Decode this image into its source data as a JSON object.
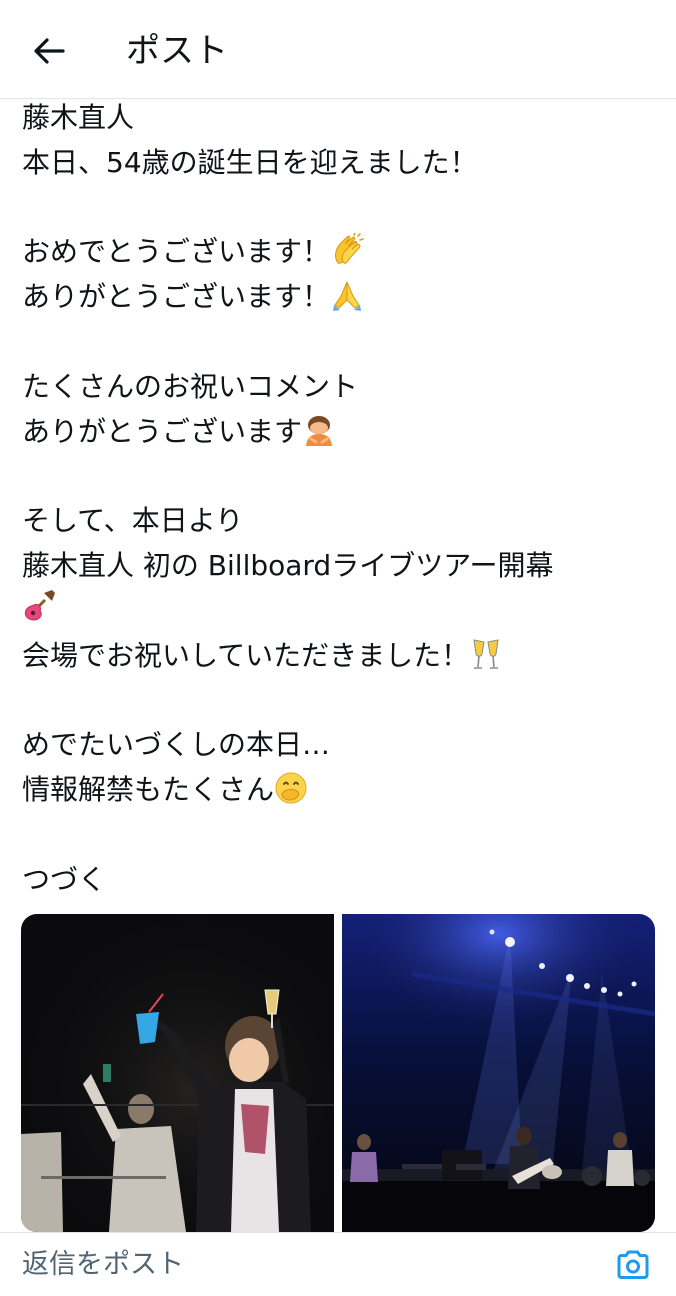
{
  "header": {
    "title": "ポスト",
    "back_icon": "arrow-left-icon"
  },
  "post": {
    "lines": [
      "藤木直人",
      "本日、54歳の誕生日を迎えました！",
      "",
      "おめでとうございます！",
      "ありがとうございます！",
      "",
      "たくさんのお祝いコメント",
      "ありがとうございます",
      "",
      "そして、本日より",
      "藤木直人 初の Billboardライブツアー開幕",
      "",
      "会場でお祝いしていただきました！",
      "",
      "めでたいづくしの本日…",
      "情報解禁もたくさん",
      "",
      "つづく"
    ],
    "emojis": [
      "clapping-hands-icon",
      "folded-hands-icon",
      "person-bowing-icon",
      "guitar-icon",
      "clinking-glasses-icon",
      "face-with-hand-over-mouth-icon"
    ]
  },
  "media": {
    "photos": [
      "concert-photo-toast",
      "concert-photo-stage"
    ]
  },
  "reply": {
    "placeholder": "返信をポスト",
    "camera_icon": "camera-icon"
  },
  "colors": {
    "text": "#0f1419",
    "muted": "#536471",
    "accent": "#1d9bf0",
    "divider": "#e3e6e8"
  }
}
